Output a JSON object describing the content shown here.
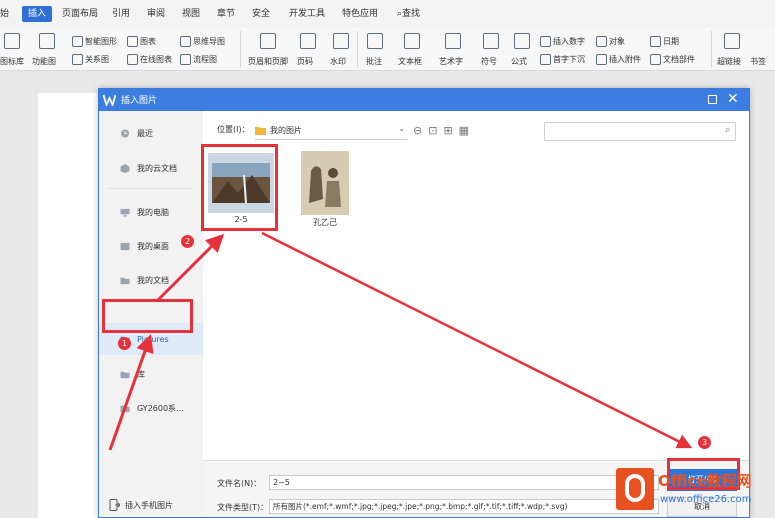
{
  "ribbon": {
    "tabs": [
      "始",
      "插入",
      "页面布局",
      "引用",
      "审阅",
      "视图",
      "章节",
      "安全",
      "开发工具",
      "特色应用",
      "查找"
    ],
    "tools_row1": [
      "智能图形",
      "图表",
      "思维导图",
      "插入数字",
      "对象",
      "日期",
      "超链接"
    ],
    "tools_row2": [
      "图标库",
      "功能图",
      "关系图",
      "在线图表",
      "流程图",
      "页眉和页脚",
      "页码",
      "水印",
      "批注",
      "文本框",
      "艺术字",
      "符号",
      "公式",
      "首字下沉",
      "插入附件",
      "文档部件",
      "书签"
    ]
  },
  "dialog": {
    "title": "插入图片",
    "sidebar": [
      "最近",
      "我的云文档",
      "我的电脑",
      "我的桌面",
      "我的文档",
      "Pictures",
      "库",
      "GY2600系..."
    ],
    "location_label": "位置(I)：",
    "location_value": "我的图片",
    "files": [
      {
        "name": "2-5"
      },
      {
        "name": "孔乙己"
      }
    ],
    "filename_label": "文件名(N)：",
    "filename_value": "2~5",
    "filetype_label": "文件类型(T)：",
    "filetype_value": "所有图片(*.emf;*.wmf;*.jpg;*.jpeg;*.jpe;*.png;*.bmp;*.gif;*.tif;*.tiff;*.wdp;*.svg)",
    "open_label": "打开(O)",
    "cancel_label": "取消",
    "mobile_label": "插入手机图片"
  },
  "annotations": [
    "1",
    "2",
    "3"
  ],
  "watermark": {
    "line1": "Office教程网",
    "line2": "www.office26.com"
  },
  "colors": {
    "accent": "#3b7de0",
    "annotation": "#e6303a",
    "watermark": "#e8501f"
  }
}
